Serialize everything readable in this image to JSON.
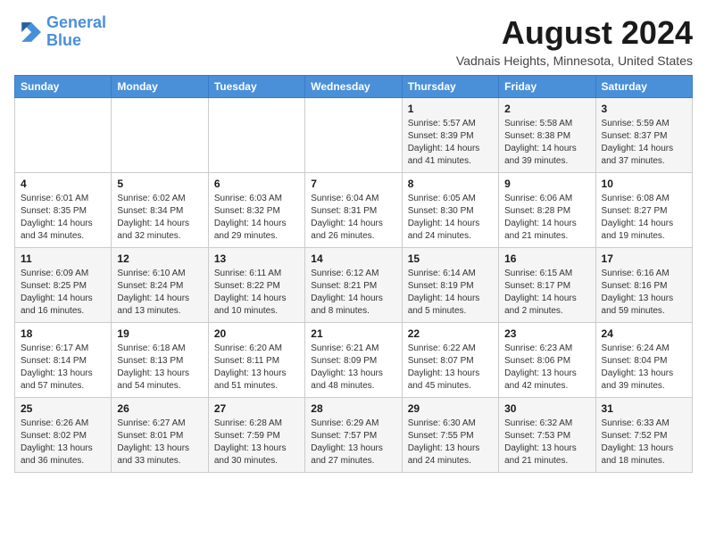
{
  "header": {
    "logo_line1": "General",
    "logo_line2": "Blue",
    "month_year": "August 2024",
    "location": "Vadnais Heights, Minnesota, United States"
  },
  "weekdays": [
    "Sunday",
    "Monday",
    "Tuesday",
    "Wednesday",
    "Thursday",
    "Friday",
    "Saturday"
  ],
  "weeks": [
    [
      {
        "day": "",
        "info": ""
      },
      {
        "day": "",
        "info": ""
      },
      {
        "day": "",
        "info": ""
      },
      {
        "day": "",
        "info": ""
      },
      {
        "day": "1",
        "info": "Sunrise: 5:57 AM\nSunset: 8:39 PM\nDaylight: 14 hours\nand 41 minutes."
      },
      {
        "day": "2",
        "info": "Sunrise: 5:58 AM\nSunset: 8:38 PM\nDaylight: 14 hours\nand 39 minutes."
      },
      {
        "day": "3",
        "info": "Sunrise: 5:59 AM\nSunset: 8:37 PM\nDaylight: 14 hours\nand 37 minutes."
      }
    ],
    [
      {
        "day": "4",
        "info": "Sunrise: 6:01 AM\nSunset: 8:35 PM\nDaylight: 14 hours\nand 34 minutes."
      },
      {
        "day": "5",
        "info": "Sunrise: 6:02 AM\nSunset: 8:34 PM\nDaylight: 14 hours\nand 32 minutes."
      },
      {
        "day": "6",
        "info": "Sunrise: 6:03 AM\nSunset: 8:32 PM\nDaylight: 14 hours\nand 29 minutes."
      },
      {
        "day": "7",
        "info": "Sunrise: 6:04 AM\nSunset: 8:31 PM\nDaylight: 14 hours\nand 26 minutes."
      },
      {
        "day": "8",
        "info": "Sunrise: 6:05 AM\nSunset: 8:30 PM\nDaylight: 14 hours\nand 24 minutes."
      },
      {
        "day": "9",
        "info": "Sunrise: 6:06 AM\nSunset: 8:28 PM\nDaylight: 14 hours\nand 21 minutes."
      },
      {
        "day": "10",
        "info": "Sunrise: 6:08 AM\nSunset: 8:27 PM\nDaylight: 14 hours\nand 19 minutes."
      }
    ],
    [
      {
        "day": "11",
        "info": "Sunrise: 6:09 AM\nSunset: 8:25 PM\nDaylight: 14 hours\nand 16 minutes."
      },
      {
        "day": "12",
        "info": "Sunrise: 6:10 AM\nSunset: 8:24 PM\nDaylight: 14 hours\nand 13 minutes."
      },
      {
        "day": "13",
        "info": "Sunrise: 6:11 AM\nSunset: 8:22 PM\nDaylight: 14 hours\nand 10 minutes."
      },
      {
        "day": "14",
        "info": "Sunrise: 6:12 AM\nSunset: 8:21 PM\nDaylight: 14 hours\nand 8 minutes."
      },
      {
        "day": "15",
        "info": "Sunrise: 6:14 AM\nSunset: 8:19 PM\nDaylight: 14 hours\nand 5 minutes."
      },
      {
        "day": "16",
        "info": "Sunrise: 6:15 AM\nSunset: 8:17 PM\nDaylight: 14 hours\nand 2 minutes."
      },
      {
        "day": "17",
        "info": "Sunrise: 6:16 AM\nSunset: 8:16 PM\nDaylight: 13 hours\nand 59 minutes."
      }
    ],
    [
      {
        "day": "18",
        "info": "Sunrise: 6:17 AM\nSunset: 8:14 PM\nDaylight: 13 hours\nand 57 minutes."
      },
      {
        "day": "19",
        "info": "Sunrise: 6:18 AM\nSunset: 8:13 PM\nDaylight: 13 hours\nand 54 minutes."
      },
      {
        "day": "20",
        "info": "Sunrise: 6:20 AM\nSunset: 8:11 PM\nDaylight: 13 hours\nand 51 minutes."
      },
      {
        "day": "21",
        "info": "Sunrise: 6:21 AM\nSunset: 8:09 PM\nDaylight: 13 hours\nand 48 minutes."
      },
      {
        "day": "22",
        "info": "Sunrise: 6:22 AM\nSunset: 8:07 PM\nDaylight: 13 hours\nand 45 minutes."
      },
      {
        "day": "23",
        "info": "Sunrise: 6:23 AM\nSunset: 8:06 PM\nDaylight: 13 hours\nand 42 minutes."
      },
      {
        "day": "24",
        "info": "Sunrise: 6:24 AM\nSunset: 8:04 PM\nDaylight: 13 hours\nand 39 minutes."
      }
    ],
    [
      {
        "day": "25",
        "info": "Sunrise: 6:26 AM\nSunset: 8:02 PM\nDaylight: 13 hours\nand 36 minutes."
      },
      {
        "day": "26",
        "info": "Sunrise: 6:27 AM\nSunset: 8:01 PM\nDaylight: 13 hours\nand 33 minutes."
      },
      {
        "day": "27",
        "info": "Sunrise: 6:28 AM\nSunset: 7:59 PM\nDaylight: 13 hours\nand 30 minutes."
      },
      {
        "day": "28",
        "info": "Sunrise: 6:29 AM\nSunset: 7:57 PM\nDaylight: 13 hours\nand 27 minutes."
      },
      {
        "day": "29",
        "info": "Sunrise: 6:30 AM\nSunset: 7:55 PM\nDaylight: 13 hours\nand 24 minutes."
      },
      {
        "day": "30",
        "info": "Sunrise: 6:32 AM\nSunset: 7:53 PM\nDaylight: 13 hours\nand 21 minutes."
      },
      {
        "day": "31",
        "info": "Sunrise: 6:33 AM\nSunset: 7:52 PM\nDaylight: 13 hours\nand 18 minutes."
      }
    ]
  ]
}
